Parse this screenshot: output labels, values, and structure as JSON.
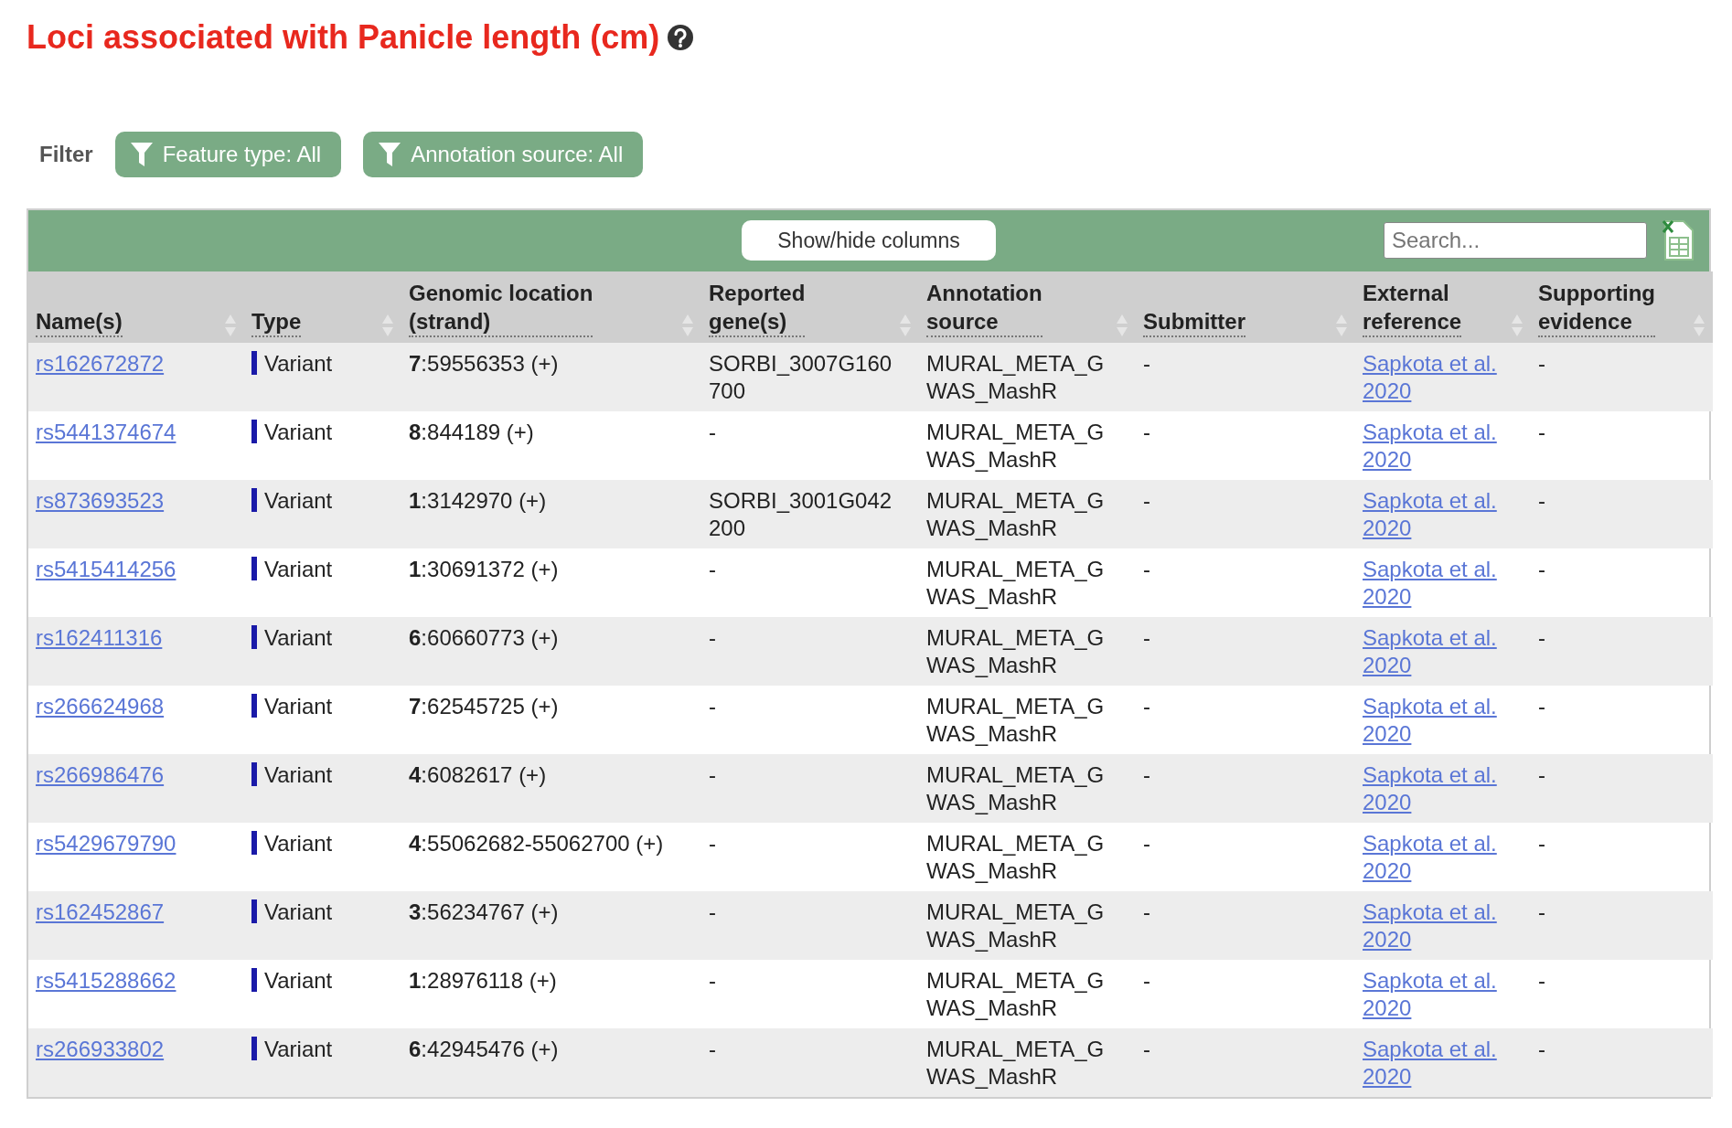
{
  "title": "Loci associated with Panicle length (cm)",
  "filter": {
    "label": "Filter",
    "buttons": [
      "Feature type: All",
      "Annotation source: All"
    ]
  },
  "toolbar": {
    "columns_button": "Show/hide columns",
    "search": {
      "placeholder": "Search..."
    }
  },
  "table": {
    "columns": [
      [
        "Name(s)"
      ],
      [
        "Type"
      ],
      [
        "Genomic location",
        "(strand)"
      ],
      [
        "Reported",
        "gene(s)"
      ],
      [
        "Annotation",
        "source"
      ],
      [
        "Submitter"
      ],
      [
        "External",
        "reference"
      ],
      [
        "Supporting",
        "evidence"
      ]
    ],
    "rows": [
      {
        "name": "rs162672872",
        "type": "Variant",
        "location": "**7**:59556353 (+)",
        "genes": "SORBI_3007G160700",
        "source": "MURAL_META_GWAS_MashR",
        "submitter": "-",
        "reference": "Sapkota et al. 2020",
        "evidence": "-"
      },
      {
        "name": "rs5441374674",
        "type": "Variant",
        "location": "**8**:844189 (+)",
        "genes": "-",
        "source": "MURAL_META_GWAS_MashR",
        "submitter": "-",
        "reference": "Sapkota et al. 2020",
        "evidence": "-"
      },
      {
        "name": "rs873693523",
        "type": "Variant",
        "location": "**1**:3142970 (+)",
        "genes": "SORBI_3001G042200",
        "source": "MURAL_META_GWAS_MashR",
        "submitter": "-",
        "reference": "Sapkota et al. 2020",
        "evidence": "-"
      },
      {
        "name": "rs5415414256",
        "type": "Variant",
        "location": "**1**:30691372 (+)",
        "genes": "-",
        "source": "MURAL_META_GWAS_MashR",
        "submitter": "-",
        "reference": "Sapkota et al. 2020",
        "evidence": "-"
      },
      {
        "name": "rs162411316",
        "type": "Variant",
        "location": "**6**:60660773 (+)",
        "genes": "-",
        "source": "MURAL_META_GWAS_MashR",
        "submitter": "-",
        "reference": "Sapkota et al. 2020",
        "evidence": "-"
      },
      {
        "name": "rs266624968",
        "type": "Variant",
        "location": "**7**:62545725 (+)",
        "genes": "-",
        "source": "MURAL_META_GWAS_MashR",
        "submitter": "-",
        "reference": "Sapkota et al. 2020",
        "evidence": "-"
      },
      {
        "name": "rs266986476",
        "type": "Variant",
        "location": "**4**:6082617 (+)",
        "genes": "-",
        "source": "MURAL_META_GWAS_MashR",
        "submitter": "-",
        "reference": "Sapkota et al. 2020",
        "evidence": "-"
      },
      {
        "name": "rs5429679790",
        "type": "Variant",
        "location": "**4**:55062682-55062700 (+)",
        "genes": "-",
        "source": "MURAL_META_GWAS_MashR",
        "submitter": "-",
        "reference": "Sapkota et al. 2020",
        "evidence": "-"
      },
      {
        "name": "rs162452867",
        "type": "Variant",
        "location": "**3**:56234767 (+)",
        "genes": "-",
        "source": "MURAL_META_GWAS_MashR",
        "submitter": "-",
        "reference": "Sapkota et al. 2020",
        "evidence": "-"
      },
      {
        "name": "rs5415288662",
        "type": "Variant",
        "location": "**1**:28976118 (+)",
        "genes": "-",
        "source": "MURAL_META_GWAS_MashR",
        "submitter": "-",
        "reference": "Sapkota et al. 2020",
        "evidence": "-"
      },
      {
        "name": "rs266933802",
        "type": "Variant",
        "location": "**6**:42945476 (+)",
        "genes": "-",
        "source": "MURAL_META_GWAS_MashR",
        "submitter": "-",
        "reference": "Sapkota et al. 2020",
        "evidence": "-"
      }
    ]
  }
}
